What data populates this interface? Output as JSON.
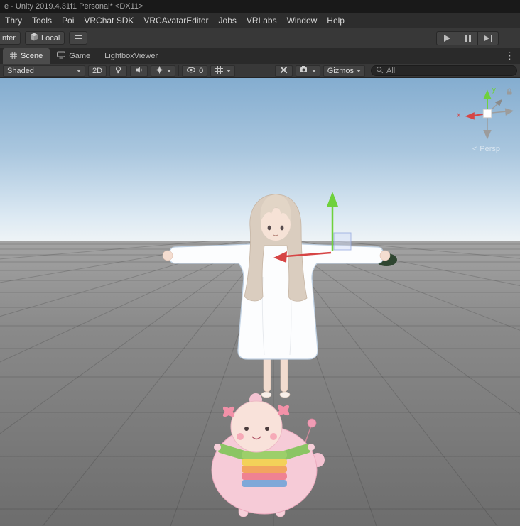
{
  "colors": {
    "axis_x": "#d64545",
    "axis_y": "#6fd13c",
    "axis_grey": "#999999",
    "selection_outline": "#bfd0e2"
  },
  "title_bar": {
    "title": "e - Unity 2019.4.31f1 Personal* <DX11>"
  },
  "menu_bar": {
    "items": [
      "Thry",
      "Tools",
      "Poi",
      "VRChat SDK",
      "VRCAvatarEditor",
      "Jobs",
      "VRLabs",
      "Window",
      "Help"
    ]
  },
  "toolbar": {
    "pivot_fragment": "nter",
    "rotation_mode": "Local"
  },
  "tabs": {
    "scene": "Scene",
    "game": "Game",
    "lightbox": "LightboxViewer",
    "overflow": "⋮"
  },
  "scene_toolbar": {
    "draw_mode": "Shaded",
    "mode_2d": "2D",
    "hidden_count": "0",
    "gizmos": "Gizmos",
    "search_value": "All"
  },
  "viewport": {
    "axis_x_label": "x",
    "axis_y_label": "y",
    "persp_chevron": "<",
    "persp_label": "Persp"
  }
}
